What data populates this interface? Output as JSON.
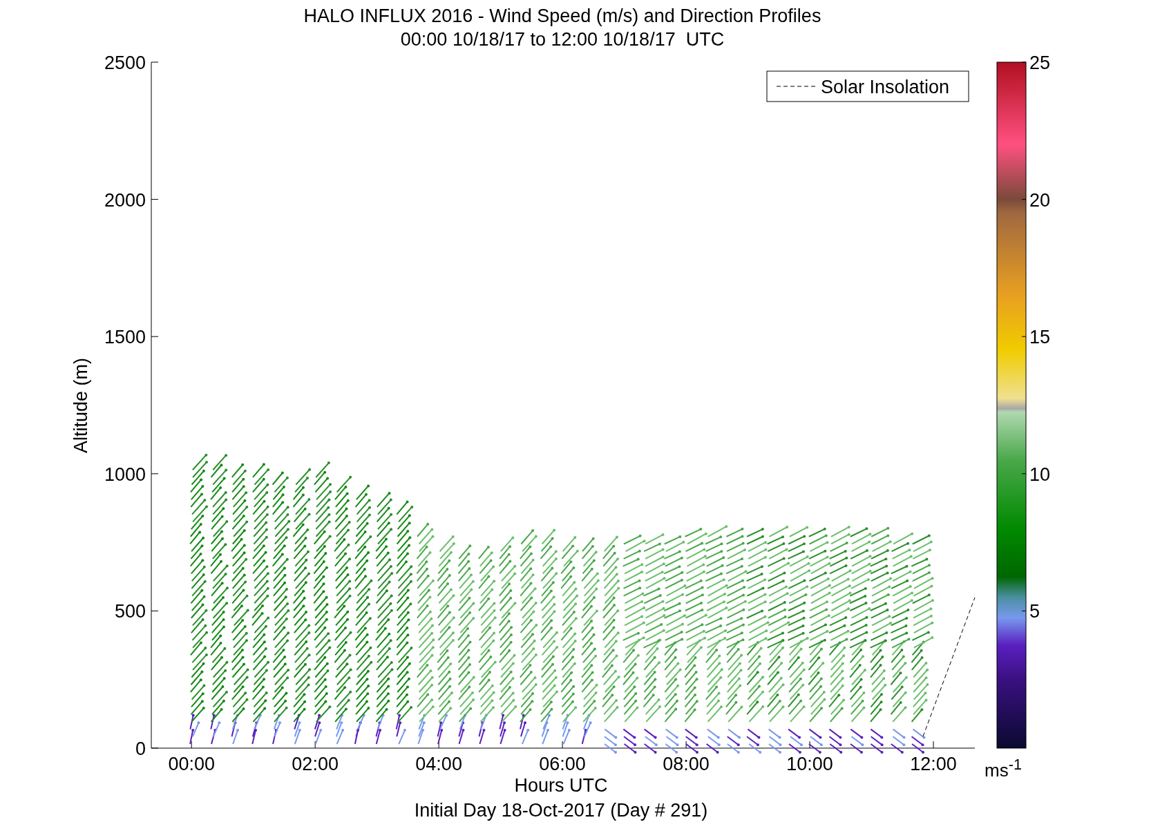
{
  "title": "HALO INFLUX 2016 - Wind Speed (m/s) and Direction Profiles",
  "subtitle": "00:00 10/18/17 to 12:00 10/18/17  UTC",
  "y_axis": {
    "label": "Altitude (m)",
    "ticks": [
      "2500",
      "2000",
      "1500",
      "1000",
      "500",
      "0"
    ]
  },
  "x_axis": {
    "label": "Hours UTC",
    "ticks": [
      "00:00",
      "02:00",
      "04:00",
      "06:00",
      "08:00",
      "10:00",
      "12:00"
    ]
  },
  "caption": "Initial Day 18-Oct-2017 (Day # 291)",
  "legend": [
    {
      "label": "Solar Insolation"
    }
  ],
  "colorbar": {
    "ticks": [
      "25",
      "20",
      "15",
      "10",
      "5"
    ],
    "unit": "ms$^{-1}$"
  }
}
